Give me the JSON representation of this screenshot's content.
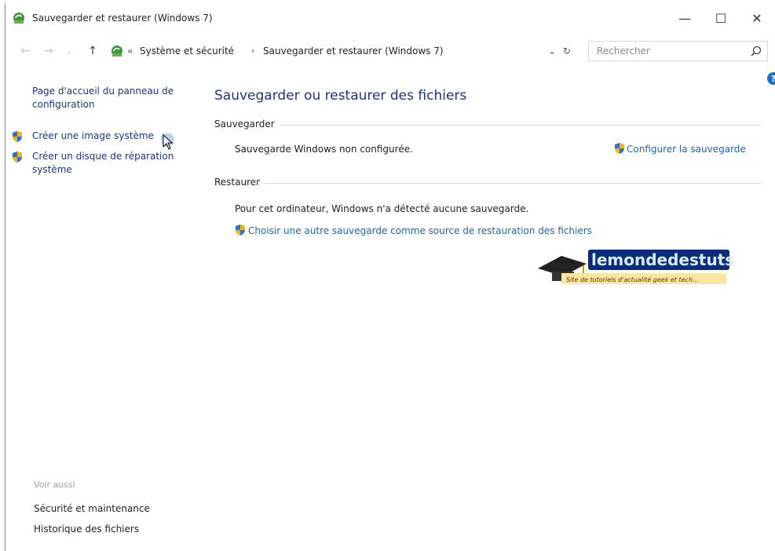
{
  "window": {
    "title": "Sauvegarder et restaurer (Windows 7)",
    "minimize_glyph": "—",
    "maximize_glyph": "☐",
    "close_glyph": "✕"
  },
  "addressbar": {
    "back_glyph": "←",
    "forward_glyph": "→",
    "recent_glyph": "⌄",
    "up_glyph": "↑",
    "overflow": "«",
    "crumbs": [
      "Système et sécurité",
      "Sauvegarder et restaurer (Windows 7)"
    ],
    "separator": "›",
    "dropdown_glyph": "⌄",
    "refresh_glyph": "↻",
    "search_placeholder": "Rechercher"
  },
  "leftpane": {
    "home_link": "Page d'accueil du panneau de configuration",
    "tasks": [
      {
        "label": "Créer une image système",
        "icon": "uac-shield-icon"
      },
      {
        "label": "Créer un disque de réparation système",
        "icon": "uac-shield-icon"
      }
    ],
    "see_also_heading": "Voir aussi",
    "see_also": [
      "Sécurité et maintenance",
      "Historique des fichiers"
    ]
  },
  "main": {
    "title": "Sauvegarder ou restaurer des fichiers",
    "backup": {
      "heading": "Sauvegarder",
      "status": "Sauvegarde Windows non configurée.",
      "action": "Configurer la sauvegarde"
    },
    "restore": {
      "heading": "Restaurer",
      "status": "Pour cet ordinateur, Windows n'a détecté aucune sauvegarde.",
      "action": "Choisir une autre sauvegarde comme source de restauration des fichiers"
    }
  },
  "watermark": {
    "brand": "lemondedestuts",
    "tagline": "Site de tutoriels d'actualité geek et tech..."
  },
  "colors": {
    "link": "#1a66b0",
    "nav_link": "#1e3287",
    "title": "#1e3287",
    "shield_blue": "#2f6fd0",
    "shield_gold": "#f2b705"
  }
}
